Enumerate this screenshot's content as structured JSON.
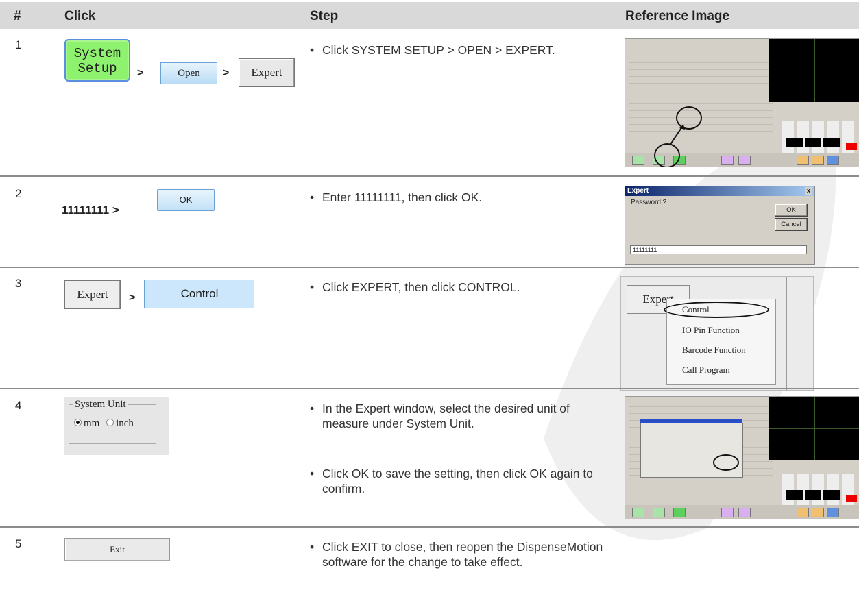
{
  "header": {
    "col_num": "#",
    "col_click": "Click",
    "col_step": "Step",
    "col_ref": "Reference Image"
  },
  "rows": [
    {
      "num": "1",
      "click": {
        "system_setup_line1": "System",
        "system_setup_line2": "Setup",
        "sep1": ">",
        "open": "Open",
        "sep2": ">",
        "expert": "Expert"
      },
      "steps": [
        "Click SYSTEM SETUP > OPEN > EXPERT."
      ]
    },
    {
      "num": "2",
      "click": {
        "password": "11111111",
        "sep": ">",
        "ok": "OK"
      },
      "steps": [
        "Enter 11111111, then click OK."
      ]
    },
    {
      "num": "3",
      "click": {
        "expert": "Expert",
        "sep": ">",
        "control": "Control"
      },
      "steps": [
        "Click EXPERT, then click CONTROL."
      ]
    },
    {
      "num": "4",
      "click": {
        "group_label": "System Unit",
        "opt_mm": "mm",
        "opt_inch": "inch"
      },
      "steps": [
        "In the Expert window, select the desired unit of measure under System Unit.",
        "Click OK to save the setting, then click OK again to confirm."
      ]
    },
    {
      "num": "5",
      "click": {
        "exit": "Exit"
      },
      "steps": [
        "Click EXIT to close, then reopen the DispenseMotion software for the change to take effect."
      ]
    }
  ],
  "ref_expert_dialog": {
    "title": "Expert",
    "close": "x",
    "prompt": "Password ?",
    "ok": "OK",
    "cancel": "Cancel",
    "value": "11111111"
  },
  "ref_expert_menu": {
    "button": "Expert",
    "items": [
      "Control",
      "IO Pin Function",
      "Barcode Function",
      "Call Program"
    ]
  },
  "bullet_glyph": "•"
}
